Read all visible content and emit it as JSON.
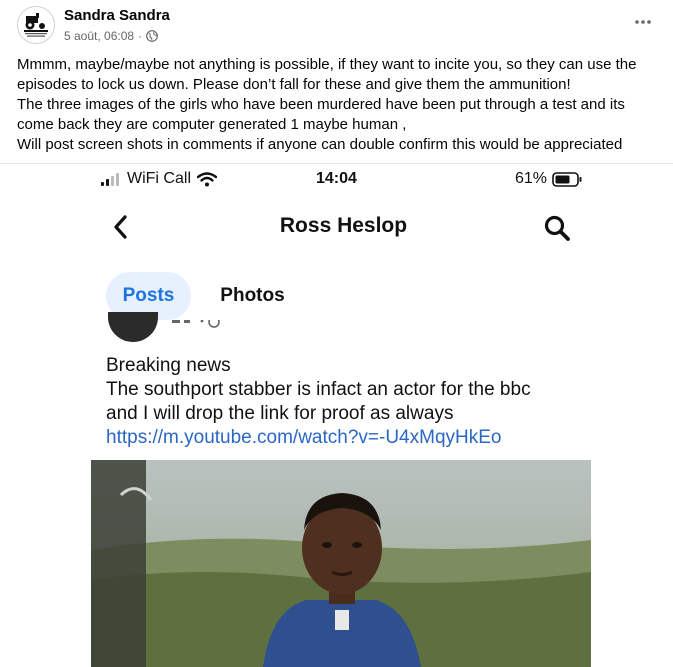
{
  "post": {
    "author": "Sandra Sandra",
    "date": "5 août, 06:08",
    "audience_icon": "globe-icon",
    "paragraphs": [
      "Mmmm, maybe/maybe not anything is possible, if they want to incite you, so they can use the episodes to lock us down. Please don’t fall for these and give them the ammunition!",
      "The three images of the girls who have been murdered have been put through a test and its come back they are computer generated 1 maybe human ,",
      "Will post screen shots in comments if anyone can double confirm this would be appreciated"
    ]
  },
  "screenshot": {
    "status_bar": {
      "carrier": "WiFi Call",
      "time": "14:04",
      "battery": "61%"
    },
    "nav": {
      "title": "Ross Heslop"
    },
    "tabs": [
      {
        "label": "Posts",
        "active": true
      },
      {
        "label": "Photos",
        "active": false
      }
    ],
    "inner_post": {
      "lines": [
        "Breaking news",
        "The southport stabber is infact an actor for the bbc",
        "and I will drop the link for proof as always"
      ],
      "link": "https://m.youtube.com/watch?v=-U4xMqyHkEo"
    }
  },
  "colors": {
    "accent": "#1b74e4",
    "link": "#2a66c4",
    "active_tab_bg": "#e7f0fd",
    "meta_text": "#65676b"
  }
}
